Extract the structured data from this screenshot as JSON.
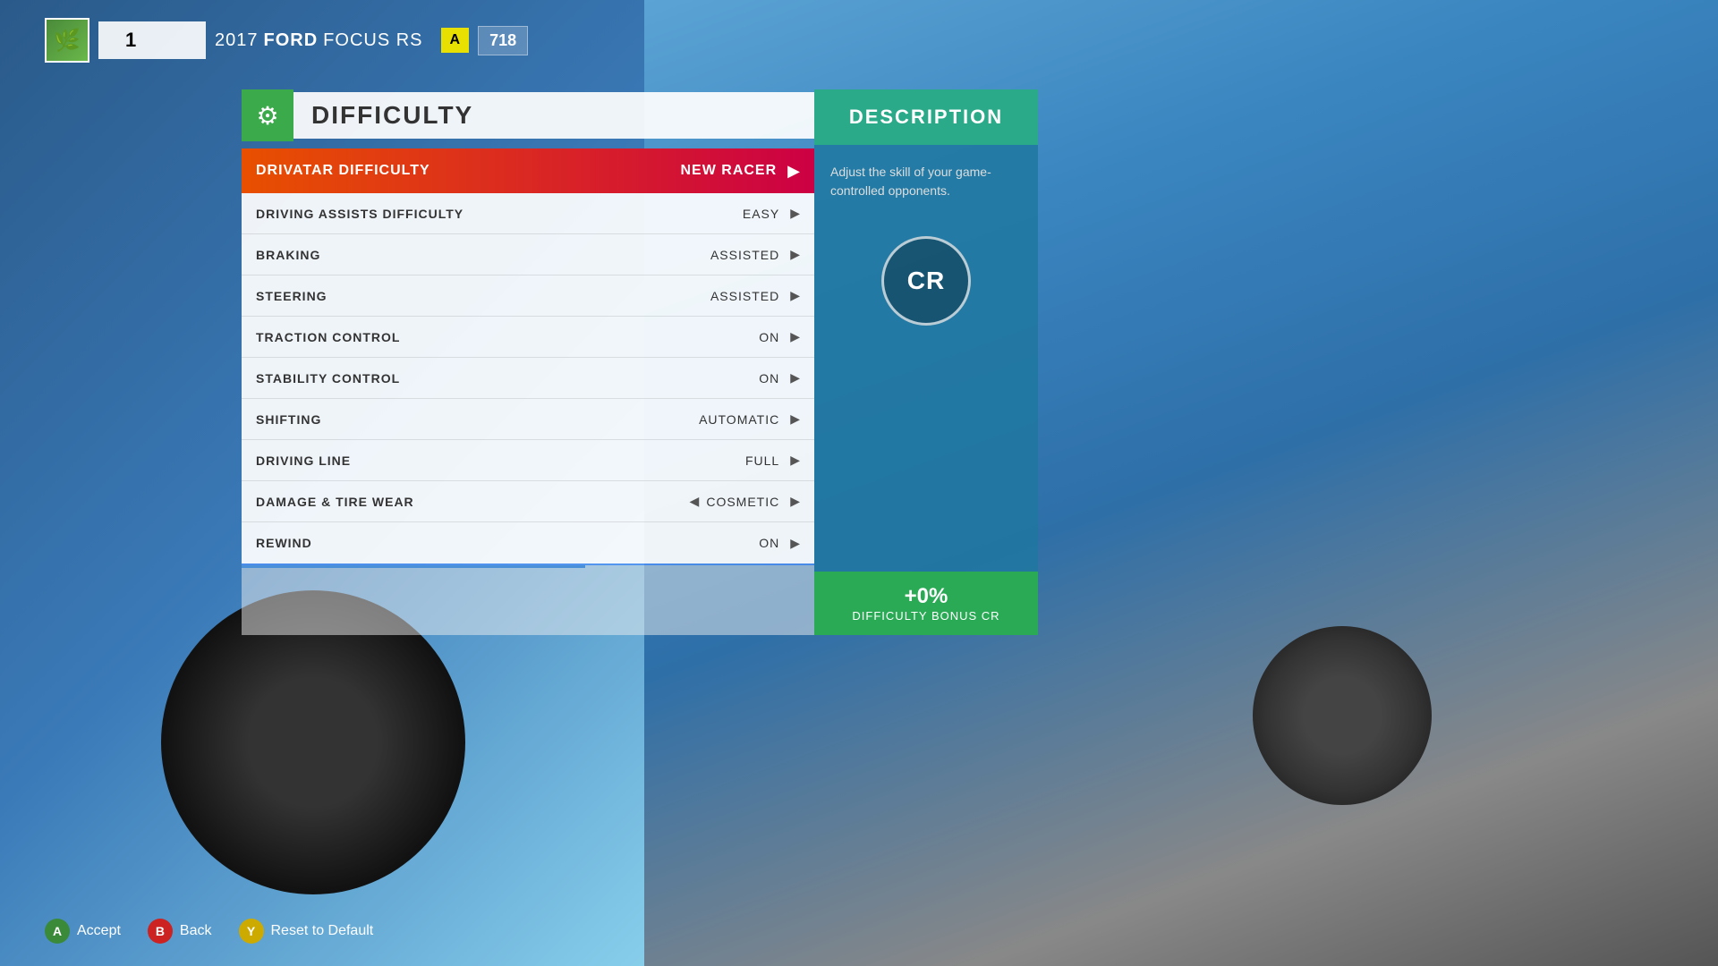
{
  "background": {
    "car_color": "#3a85c0"
  },
  "top_bar": {
    "player_number": "1",
    "car_year": "2017",
    "car_brand": "FORD",
    "car_model": "FOCUS RS",
    "car_class": "A",
    "car_rating": "718"
  },
  "panel": {
    "title": "DIFFICULTY",
    "gear_icon": "⚙"
  },
  "drivatar": {
    "label": "DRIVATAR DIFFICULTY",
    "value": "NEW RACER",
    "arrow": "▶"
  },
  "settings": [
    {
      "label": "DRIVING ASSISTS DIFFICULTY",
      "value": "EASY",
      "has_left_arrow": false
    },
    {
      "label": "BRAKING",
      "value": "ASSISTED",
      "has_left_arrow": false
    },
    {
      "label": "STEERING",
      "value": "ASSISTED",
      "has_left_arrow": false
    },
    {
      "label": "TRACTION CONTROL",
      "value": "ON",
      "has_left_arrow": false
    },
    {
      "label": "STABILITY CONTROL",
      "value": "ON",
      "has_left_arrow": false
    },
    {
      "label": "SHIFTING",
      "value": "AUTOMATIC",
      "has_left_arrow": false
    },
    {
      "label": "DRIVING LINE",
      "value": "FULL",
      "has_left_arrow": false
    },
    {
      "label": "DAMAGE & TIRE WEAR",
      "value": "COSMETIC",
      "has_left_arrow": true
    },
    {
      "label": "REWIND",
      "value": "ON",
      "has_left_arrow": false
    }
  ],
  "description": {
    "title": "DESCRIPTION",
    "text": "Adjust the skill of your game-controlled opponents.",
    "cr_label": "CR",
    "bonus_percent": "+0%",
    "bonus_label": "DIFFICULTY BONUS CR"
  },
  "bottom_controls": [
    {
      "btn": "A",
      "btn_class": "btn-a",
      "label": "Accept"
    },
    {
      "btn": "B",
      "btn_class": "btn-b",
      "label": "Back"
    },
    {
      "btn": "Y",
      "btn_class": "btn-y",
      "label": "Reset to Default"
    }
  ]
}
